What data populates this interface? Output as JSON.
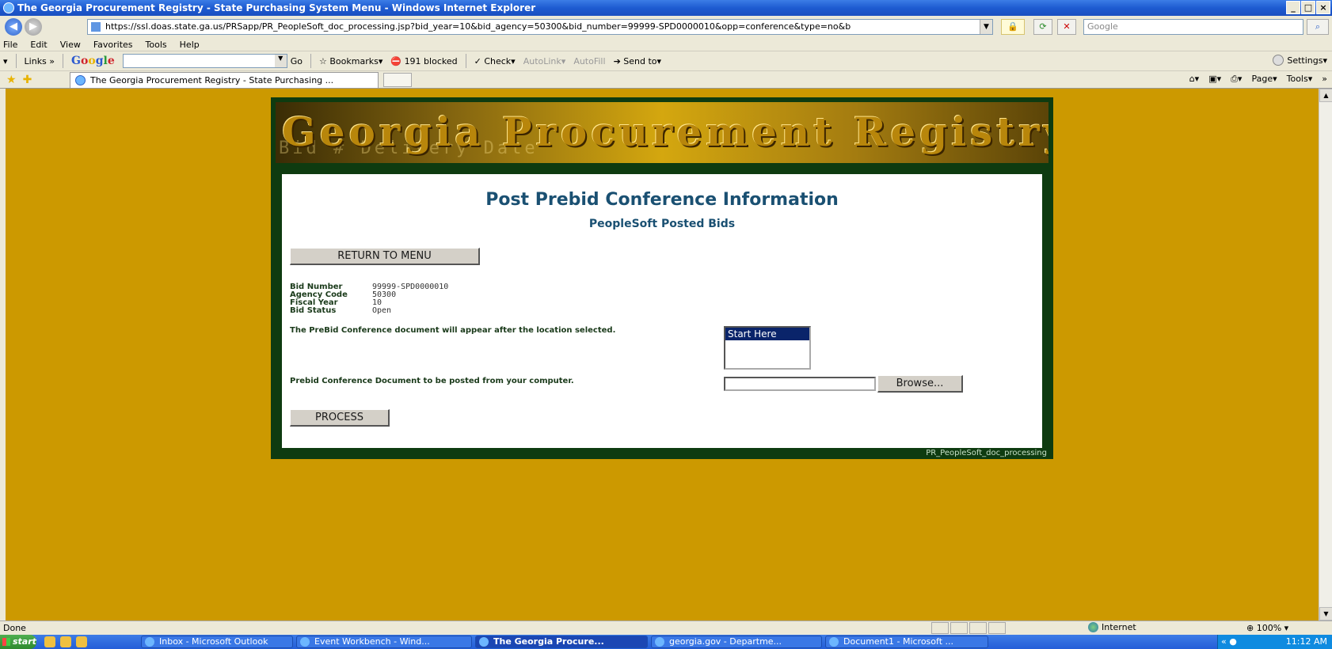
{
  "window": {
    "title": "The Georgia Procurement Registry - State Purchasing System Menu - Windows Internet Explorer",
    "controls": [
      "_",
      "х",
      "x"
    ]
  },
  "address": {
    "url": "https://ssl.doas.state.ga.us/PRSapp/PR_PeopleSoft_doc_processing.jsp?bid_year=10&bid_agency=50300&bid_number=99999-SPD0000010&opp=conference&type=no&b",
    "search_placeholder": "Google"
  },
  "menu": [
    "File",
    "Edit",
    "View",
    "Favorites",
    "Tools",
    "Help"
  ],
  "toolbar": {
    "links": "Links",
    "google": "Google",
    "go": "Go",
    "bookmarks": "Bookmarks",
    "blocked": "191 blocked",
    "check": "Check",
    "autolink": "AutoLink",
    "autofill": "AutoFill",
    "sendto": "Send to",
    "settings": "Settings"
  },
  "tab": {
    "title": "The Georgia Procurement Registry - State Purchasing ...",
    "page_menu": "Page",
    "tools_menu": "Tools"
  },
  "page": {
    "banner_title": "Georgia Procurement Registry",
    "banner_bgtext": "Bid #    Delivery  Date",
    "heading": "Post Prebid Conference Information",
    "subheading": "PeopleSoft Posted Bids",
    "return_button": "RETURN TO MENU",
    "fields": [
      {
        "label": "Bid Number",
        "value": "99999-SPD0000010"
      },
      {
        "label": "Agency Code",
        "value": "50300"
      },
      {
        "label": "Fiscal Year",
        "value": "10"
      },
      {
        "label": "Bid Status",
        "value": "Open"
      }
    ],
    "location_message": "The PreBid Conference document will appear after the location selected.",
    "location_option": "Start Here",
    "upload_message": "Prebid Conference Document to be posted from your computer.",
    "browse_button": "Browse...",
    "process_button": "PROCESS",
    "footer_label": "PR_PeopleSoft_doc_processing"
  },
  "status": {
    "text": "Done",
    "zone": "Internet",
    "zoom": "100%"
  },
  "taskbar": {
    "start": "start",
    "tasks": [
      {
        "label": "Inbox - Microsoft Outlook",
        "active": false
      },
      {
        "label": "Event Workbench - Wind...",
        "active": false
      },
      {
        "label": "The Georgia Procure...",
        "active": true
      },
      {
        "label": "georgia.gov - Departme...",
        "active": false
      },
      {
        "label": "Document1 - Microsoft ...",
        "active": false
      }
    ],
    "clock": "11:12 AM"
  },
  "colors": {
    "page_background": "#cc9900",
    "panel_border": "#0e3b10",
    "heading": "#1a5072"
  }
}
